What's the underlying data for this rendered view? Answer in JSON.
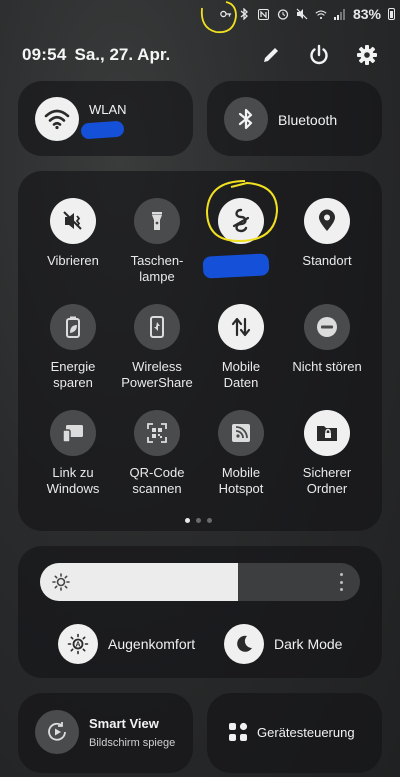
{
  "status": {
    "battery": "83%",
    "icons": [
      "key-icon",
      "bluetooth-icon",
      "nfc-icon",
      "alarm-icon",
      "mute-icon",
      "wifi-icon",
      "signal-icon",
      "battery-icon"
    ]
  },
  "header": {
    "time": "09:54",
    "date": "Sa., 27. Apr."
  },
  "wifi": {
    "label": "WLAN",
    "on": true
  },
  "bluetooth": {
    "label": "Bluetooth",
    "on": false
  },
  "tiles": {
    "vibrate": {
      "label": "Vibrieren",
      "icon": "vibrate-icon"
    },
    "flashlight": {
      "label": "Taschen-\nlampe",
      "icon": "flashlight-icon"
    },
    "vpn": {
      "label": "",
      "icon": "vpn-app-icon"
    },
    "location": {
      "label": "Standort",
      "icon": "location-pin-icon"
    },
    "power_saving": {
      "label": "Energie\nsparen",
      "icon": "battery-leaf-icon"
    },
    "wireless_powershare": {
      "label": "Wireless\nPowerShare",
      "icon": "wireless-powershare-icon"
    },
    "mobile_data": {
      "label": "Mobile\nDaten",
      "icon": "data-arrows-icon"
    },
    "dnd": {
      "label": "Nicht stören",
      "icon": "dnd-icon"
    },
    "link_windows": {
      "label": "Link zu\nWindows",
      "icon": "link-windows-icon"
    },
    "qr": {
      "label": "QR-Code\nscannen",
      "icon": "qr-scan-icon"
    },
    "hotspot": {
      "label": "Mobile\nHotspot",
      "icon": "hotspot-icon"
    },
    "secure_folder": {
      "label": "Sicherer\nOrdner",
      "icon": "secure-folder-icon"
    }
  },
  "brightness": {
    "level": 0.62
  },
  "modes": {
    "eye_comfort": "Augenkomfort",
    "dark_mode": "Dark Mode"
  },
  "smart_view": {
    "title": "Smart View",
    "subtitle": "Bildschirm spiege"
  },
  "device_control": {
    "label": "Gerätesteuerung"
  },
  "colors": {
    "accent_tile_on": "#f0f0f0",
    "tile_off": "#4a4b4d",
    "annotation_scribble": "#1450d8",
    "annotation_circle": "#f0e020"
  }
}
